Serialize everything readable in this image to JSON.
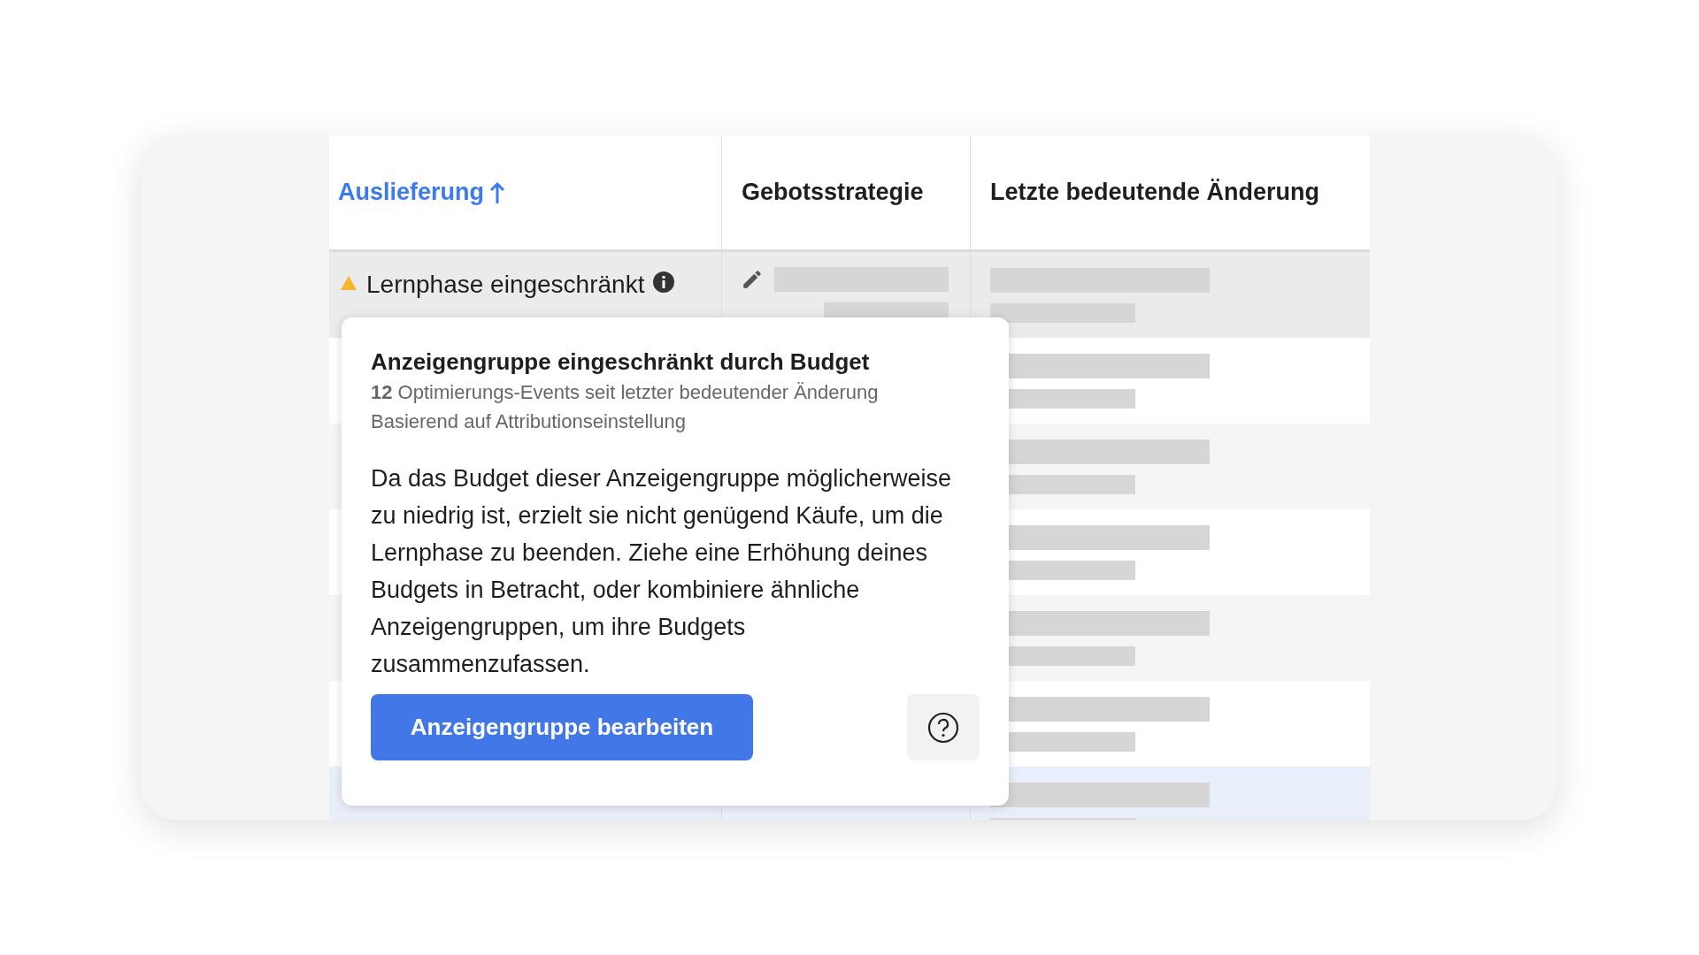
{
  "table": {
    "columns": [
      {
        "label": "Auslieferung",
        "sorted": true
      },
      {
        "label": "Gebotsstrategie",
        "sorted": false
      },
      {
        "label": "Letzte bedeutende Änderung",
        "sorted": false
      }
    ],
    "rows": [
      {
        "status": "Lernphase eingeschränkt",
        "selected": false
      },
      {
        "selected": false
      },
      {
        "selected": false
      },
      {
        "selected": false
      },
      {
        "selected": false
      },
      {
        "selected": false
      },
      {
        "selected": true
      }
    ]
  },
  "tooltip": {
    "title": "Anzeigengruppe eingeschränkt durch Budget",
    "details": [
      "**12** Optimierungs-Events seit letzter bedeutender Änderung",
      "Basierend auf Attributionseinstellung"
    ],
    "body": "Da das Budget dieser Anzeigengruppe möglicherweise zu niedrig ist, erzielt sie nicht genügend Käufe, um die Lernphase zu beenden. Ziehe eine Erhöhung deines Budgets in Betracht, oder kombiniere ähnliche Anzeigengruppen, um ihre Budgets zusammenzufassen.",
    "button": "Anzeigengruppe bearbeiten"
  }
}
